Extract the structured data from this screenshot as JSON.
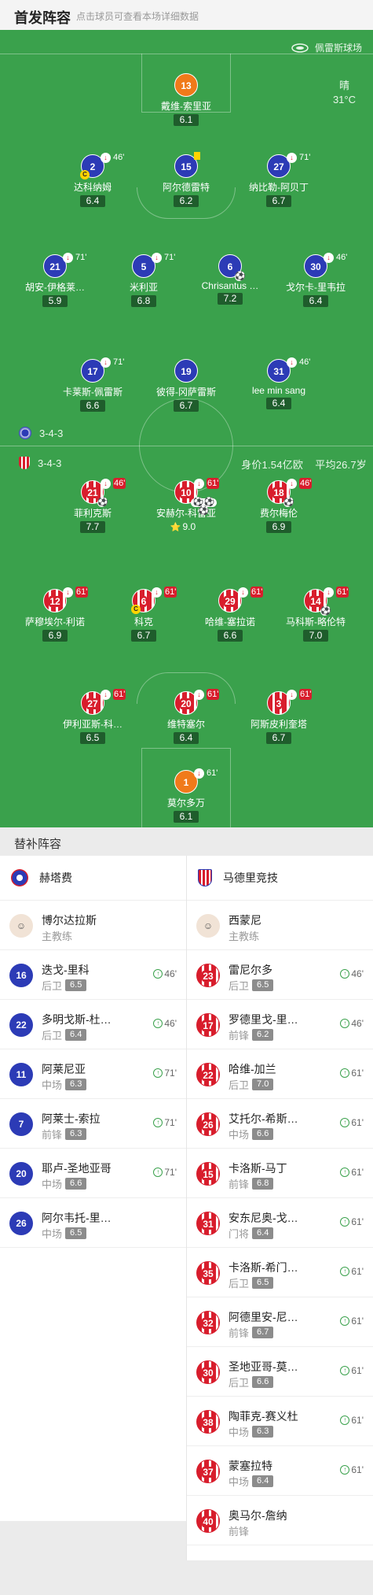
{
  "header": {
    "title": "首发阵容",
    "hint": "点击球员可查看本场详细数据"
  },
  "stadium": "佩雷斯球场",
  "weather": {
    "cond": "晴",
    "temp": "31°C"
  },
  "home": {
    "formation": "3-4-3"
  },
  "away": {
    "formation": "3-4-3",
    "value": "身价1.54亿欧",
    "age": "平均26.7岁"
  },
  "colors": {
    "pitch": "#3aa14c",
    "home": "#2c3bb6",
    "away": "#d81d2c",
    "keeper": "#f07a1a"
  },
  "players": [
    {
      "num": "13",
      "name": "戴维-索里亚",
      "rating": "6.1",
      "style": "orange"
    },
    {
      "num": "2",
      "name": "达科纳姆",
      "rating": "6.4",
      "style": "blue",
      "sub": "46'",
      "captain": "C"
    },
    {
      "num": "15",
      "name": "阿尔德雷特",
      "rating": "6.2",
      "style": "blue",
      "yellow": true
    },
    {
      "num": "27",
      "name": "纳比勒-阿贝丁",
      "rating": "6.7",
      "style": "blue",
      "sub": "71'"
    },
    {
      "num": "21",
      "name": "胡安-伊格莱…",
      "rating": "5.9",
      "style": "blue",
      "sub": "71'"
    },
    {
      "num": "5",
      "name": "米利亚",
      "rating": "6.8",
      "style": "blue",
      "sub": "71'"
    },
    {
      "num": "6",
      "name": "Chrisantus …",
      "rating": "7.2",
      "style": "blue",
      "balls": "⚽"
    },
    {
      "num": "30",
      "name": "戈尔卡-里韦拉",
      "rating": "6.4",
      "style": "blue",
      "sub": "46'"
    },
    {
      "num": "17",
      "name": "卡莱斯-佩雷斯",
      "rating": "6.6",
      "style": "blue",
      "sub": "71'"
    },
    {
      "num": "19",
      "name": "彼得-冈萨雷斯",
      "rating": "6.7",
      "style": "blue"
    },
    {
      "num": "31",
      "name": "lee min sang",
      "rating": "6.4",
      "style": "blue",
      "sub": "46'"
    },
    {
      "num": "21",
      "name": "菲利克斯",
      "rating": "7.7",
      "style": "stripe",
      "sub": "46'",
      "balls": "⚽"
    },
    {
      "num": "10",
      "name": "安赫尔-科雷亚",
      "rating": "9.0",
      "style": "stripe",
      "sub": "61'",
      "balls": "⚽⚽⚽",
      "star": "⭐"
    },
    {
      "num": "18",
      "name": "费尔梅伦",
      "rating": "6.9",
      "style": "stripe",
      "sub": "46'",
      "balls": "⚽"
    },
    {
      "num": "12",
      "name": "萨穆埃尔-利诺",
      "rating": "6.9",
      "style": "stripe",
      "sub": "61'"
    },
    {
      "num": "6",
      "name": "科克",
      "rating": "6.7",
      "style": "stripe",
      "sub": "61'",
      "captain": "C"
    },
    {
      "num": "29",
      "name": "哈维-塞拉诺",
      "rating": "6.6",
      "style": "stripe",
      "sub": "61'"
    },
    {
      "num": "14",
      "name": "马科斯-略伦特",
      "rating": "7.0",
      "style": "stripe",
      "sub": "61'",
      "balls": "⚽"
    },
    {
      "num": "27",
      "name": "伊利亚斯-科…",
      "rating": "6.5",
      "style": "stripe",
      "sub": "61'"
    },
    {
      "num": "20",
      "name": "维特塞尔",
      "rating": "6.4",
      "style": "stripe",
      "sub": "61'"
    },
    {
      "num": "3",
      "name": "阿斯皮利奎塔",
      "rating": "6.7",
      "style": "stripe",
      "sub": "61'"
    },
    {
      "num": "1",
      "name": "莫尔多万",
      "rating": "6.1",
      "style": "orange",
      "sub": "61'"
    }
  ],
  "subs_title": "替补阵容",
  "home_bench": {
    "team": "赫塔费",
    "coach": "博尔达拉斯",
    "coach_role": "主教练",
    "players": [
      {
        "num": "16",
        "name": "迭戈-里科",
        "pos": "后卫",
        "rating": "6.5",
        "min": "46'"
      },
      {
        "num": "22",
        "name": "多明戈斯-杜…",
        "pos": "后卫",
        "rating": "6.4",
        "min": "46'"
      },
      {
        "num": "11",
        "name": "阿莱尼亚",
        "pos": "中场",
        "rating": "6.3",
        "min": "71'"
      },
      {
        "num": "7",
        "name": "阿莱士-索拉",
        "pos": "前锋",
        "rating": "6.3",
        "min": "71'"
      },
      {
        "num": "20",
        "name": "耶卢-圣地亚哥",
        "pos": "中场",
        "rating": "6.6",
        "min": "71'"
      },
      {
        "num": "26",
        "name": "阿尔韦托-里…",
        "pos": "中场",
        "rating": "6.5",
        "min": ""
      }
    ]
  },
  "away_bench": {
    "team": "马德里竞技",
    "coach": "西蒙尼",
    "coach_role": "主教练",
    "players": [
      {
        "num": "23",
        "name": "雷尼尔多",
        "pos": "后卫",
        "rating": "6.5",
        "min": "46'"
      },
      {
        "num": "17",
        "name": "罗德里戈-里…",
        "pos": "前锋",
        "rating": "6.2",
        "min": "46'"
      },
      {
        "num": "22",
        "name": "哈维-加兰",
        "pos": "后卫",
        "rating": "7.0",
        "min": "61'"
      },
      {
        "num": "26",
        "name": "艾托尔-希斯…",
        "pos": "中场",
        "rating": "6.6",
        "min": "61'"
      },
      {
        "num": "15",
        "name": "卡洛斯-马丁",
        "pos": "前锋",
        "rating": "6.8",
        "min": "61'"
      },
      {
        "num": "31",
        "name": "安东尼奥-戈…",
        "pos": "门将",
        "rating": "6.4",
        "min": "61'"
      },
      {
        "num": "35",
        "name": "卡洛斯-希门…",
        "pos": "后卫",
        "rating": "6.5",
        "min": "61'"
      },
      {
        "num": "32",
        "name": "阿德里安-尼…",
        "pos": "前锋",
        "rating": "6.7",
        "min": "61'"
      },
      {
        "num": "30",
        "name": "圣地亚哥-莫…",
        "pos": "后卫",
        "rating": "6.6",
        "min": "61'"
      },
      {
        "num": "38",
        "name": "陶菲克-赛义杜",
        "pos": "中场",
        "rating": "6.3",
        "min": "61'"
      },
      {
        "num": "37",
        "name": "蒙塞拉特",
        "pos": "中场",
        "rating": "6.4",
        "min": "61'"
      },
      {
        "num": "40",
        "name": "奥马尔-詹纳",
        "pos": "前锋",
        "rating": "",
        "min": ""
      }
    ]
  }
}
